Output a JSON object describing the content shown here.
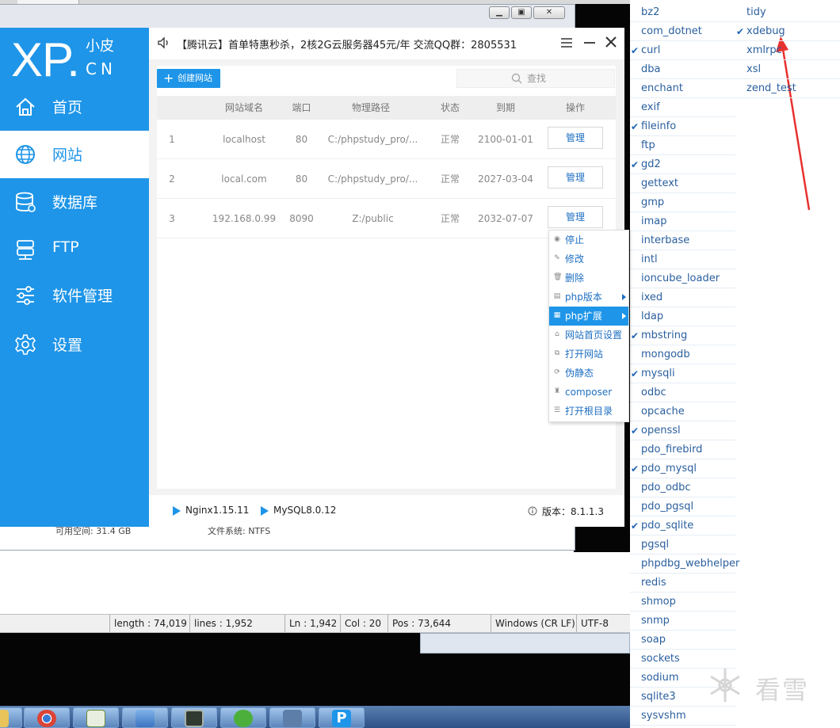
{
  "background": {
    "editor_status": {
      "length": "length : 74,019",
      "lines": "lines : 1,952",
      "ln": "Ln : 1,942",
      "col": "Col : 20",
      "pos": "Pos : 73,644",
      "eol": "Windows (CR LF)",
      "encoding": "UTF-8"
    },
    "explorer_status": {
      "free_space": "可用空间: 31.4 GB",
      "fs": "文件系统: NTFS"
    }
  },
  "app": {
    "logo": {
      "xp": "XP.",
      "cn_top": "小皮",
      "cn_bottom": "CN"
    },
    "nav": [
      {
        "label": "首页",
        "icon": "home-icon"
      },
      {
        "label": "网站",
        "icon": "globe-icon"
      },
      {
        "label": "数据库",
        "icon": "database-icon"
      },
      {
        "label": "FTP",
        "icon": "server-icon"
      },
      {
        "label": "软件管理",
        "icon": "sliders-icon"
      },
      {
        "label": "设置",
        "icon": "gear-icon"
      }
    ],
    "active_nav": "网站",
    "notice": "【腾讯云】首单特惠秒杀，2核2G云服务器45元/年 交流QQ群：2805531",
    "create_button": "创建网站",
    "search_placeholder": "查找",
    "table": {
      "headers": [
        "网站域名",
        "端口",
        "物理路径",
        "状态",
        "到期",
        "操作"
      ],
      "rows": [
        {
          "index": "1",
          "domain": "localhost",
          "port": "80",
          "path": "C:/phpstudy_pro/...",
          "status": "正常",
          "expire": "2100-01-01",
          "action": "管理"
        },
        {
          "index": "2",
          "domain": "local.com",
          "port": "80",
          "path": "C:/phpstudy_pro/...",
          "status": "正常",
          "expire": "2027-03-04",
          "action": "管理"
        },
        {
          "index": "3",
          "domain": "192.168.0.99",
          "port": "8090",
          "path": "Z:/public",
          "status": "正常",
          "expire": "2032-07-07",
          "action": "管理"
        }
      ]
    },
    "context_menu": [
      {
        "label": "停止",
        "icon": "stop-icon"
      },
      {
        "label": "修改",
        "icon": "pencil-icon"
      },
      {
        "label": "删除",
        "icon": "trash-icon"
      },
      {
        "label": "php版本",
        "icon": "php-icon",
        "submenu": true
      },
      {
        "label": "php扩展",
        "icon": "extension-icon",
        "submenu": true,
        "highlighted": true
      },
      {
        "label": "网站首页设置",
        "icon": "home-small-icon"
      },
      {
        "label": "打开网站",
        "icon": "open-icon"
      },
      {
        "label": "伪静态",
        "icon": "rewrite-icon"
      },
      {
        "label": "composer",
        "icon": "composer-icon"
      },
      {
        "label": "打开根目录",
        "icon": "folder-icon"
      }
    ],
    "footer": {
      "nginx": "Nginx1.15.11",
      "mysql": "MySQL8.0.12",
      "version": "版本：8.1.1.3"
    }
  },
  "extensions": {
    "col1": [
      {
        "name": "bz2",
        "checked": false
      },
      {
        "name": "com_dotnet",
        "checked": false
      },
      {
        "name": "curl",
        "checked": true
      },
      {
        "name": "dba",
        "checked": false
      },
      {
        "name": "enchant",
        "checked": false
      },
      {
        "name": "exif",
        "checked": false
      },
      {
        "name": "fileinfo",
        "checked": true
      },
      {
        "name": "ftp",
        "checked": false
      },
      {
        "name": "gd2",
        "checked": true
      },
      {
        "name": "gettext",
        "checked": false
      },
      {
        "name": "gmp",
        "checked": false
      },
      {
        "name": "imap",
        "checked": false
      },
      {
        "name": "interbase",
        "checked": false
      },
      {
        "name": "intl",
        "checked": false
      },
      {
        "name": "ioncube_loader",
        "checked": false
      },
      {
        "name": "ixed",
        "checked": false
      },
      {
        "name": "ldap",
        "checked": false
      },
      {
        "name": "mbstring",
        "checked": true
      },
      {
        "name": "mongodb",
        "checked": false
      },
      {
        "name": "mysqli",
        "checked": true
      },
      {
        "name": "odbc",
        "checked": false
      },
      {
        "name": "opcache",
        "checked": false
      },
      {
        "name": "openssl",
        "checked": true
      },
      {
        "name": "pdo_firebird",
        "checked": false
      },
      {
        "name": "pdo_mysql",
        "checked": true
      },
      {
        "name": "pdo_odbc",
        "checked": false
      },
      {
        "name": "pdo_pgsql",
        "checked": false
      },
      {
        "name": "pdo_sqlite",
        "checked": true
      },
      {
        "name": "pgsql",
        "checked": false
      },
      {
        "name": "phpdbg_webhelper",
        "checked": false
      },
      {
        "name": "redis",
        "checked": false
      },
      {
        "name": "shmop",
        "checked": false
      },
      {
        "name": "snmp",
        "checked": false
      },
      {
        "name": "soap",
        "checked": false
      },
      {
        "name": "sockets",
        "checked": false
      },
      {
        "name": "sodium",
        "checked": false
      },
      {
        "name": "sqlite3",
        "checked": false
      },
      {
        "name": "sysvshm",
        "checked": false
      }
    ],
    "col2": [
      {
        "name": "tidy",
        "checked": false
      },
      {
        "name": "xdebug",
        "checked": true
      },
      {
        "name": "xmlrpc",
        "checked": false
      },
      {
        "name": "xsl",
        "checked": false
      },
      {
        "name": "zend_test",
        "checked": false
      }
    ]
  },
  "colors": {
    "accent": "#1e95e8",
    "link": "#2a5f9e",
    "annotation_arrow": "#e8312f"
  },
  "watermark": {
    "text": "看雪",
    "icon": "snowflake-icon"
  }
}
